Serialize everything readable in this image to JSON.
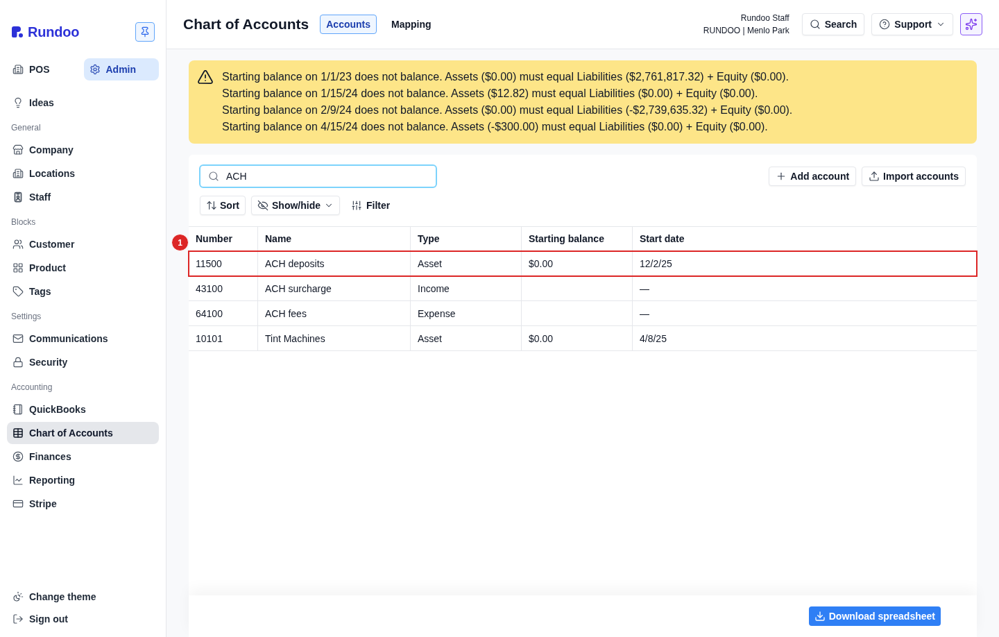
{
  "sidebar": {
    "logo": "Rundoo",
    "mode_switch": [
      {
        "label": "POS",
        "selected": false
      },
      {
        "label": "Admin",
        "selected": true
      }
    ],
    "top_items": [
      {
        "label": "Ideas",
        "selected": false
      }
    ],
    "sections": [
      {
        "title": "General",
        "items": [
          {
            "label": "Company",
            "selected": false
          },
          {
            "label": "Locations",
            "selected": false
          },
          {
            "label": "Staff",
            "selected": false
          }
        ]
      },
      {
        "title": "Blocks",
        "items": [
          {
            "label": "Customer",
            "selected": false
          },
          {
            "label": "Product",
            "selected": false
          },
          {
            "label": "Tags",
            "selected": false
          }
        ]
      },
      {
        "title": "Settings",
        "items": [
          {
            "label": "Communications",
            "selected": false
          },
          {
            "label": "Security",
            "selected": false
          }
        ]
      },
      {
        "title": "Accounting",
        "items": [
          {
            "label": "QuickBooks",
            "selected": false
          },
          {
            "label": "Chart of Accounts",
            "selected": true
          },
          {
            "label": "Finances",
            "selected": false
          },
          {
            "label": "Reporting",
            "selected": false
          },
          {
            "label": "Stripe",
            "selected": false
          }
        ]
      }
    ],
    "footer_items": [
      {
        "label": "Change theme"
      },
      {
        "label": "Sign out"
      }
    ]
  },
  "header": {
    "title": "Chart of Accounts",
    "tabs": [
      {
        "label": "Accounts",
        "selected": true
      },
      {
        "label": "Mapping",
        "selected": false
      }
    ],
    "user": {
      "name": "Rundoo Staff",
      "location": "RUNDOO | Menlo Park"
    },
    "search_button": "Search",
    "support_button": "Support"
  },
  "alert": {
    "lines": [
      "Starting balance on 1/1/23 does not balance. Assets ($0.00) must equal Liabilities ($2,761,817.32) + Equity ($0.00).",
      "Starting balance on 1/15/24 does not balance. Assets ($12.82) must equal Liabilities ($0.00) + Equity ($0.00).",
      "Starting balance on 2/9/24 does not balance. Assets ($0.00) must equal Liabilities (-$2,739,635.32) + Equity ($0.00).",
      "Starting balance on 4/15/24 does not balance. Assets (-$300.00) must equal Liabilities ($0.00) + Equity ($0.00)."
    ]
  },
  "toolbar": {
    "search": {
      "value": "ACH",
      "focused": true
    },
    "add_button": "Add account",
    "import_button": "Import accounts",
    "sort_button": "Sort",
    "show_hide_button": "Show/hide",
    "filter_button": "Filter"
  },
  "table": {
    "columns": [
      "Number",
      "Name",
      "Type",
      "Starting balance",
      "Start date"
    ],
    "rows": [
      {
        "number": "11500",
        "name": "ACH deposits",
        "type": "Asset",
        "starting_balance": "$0.00",
        "start_date": "12/2/25",
        "outlined": true,
        "marker": "1"
      },
      {
        "number": "43100",
        "name": "ACH surcharge",
        "type": "Income",
        "start_date": "—",
        "outlined": false
      },
      {
        "number": "64100",
        "name": "ACH fees",
        "type": "Expense",
        "start_date": "—",
        "outlined": false
      },
      {
        "number": "10101",
        "name": "Tint Machines",
        "type": "Asset",
        "starting_balance": "$0.00",
        "start_date": "4/8/25",
        "outlined": false
      }
    ]
  },
  "footer": {
    "download_button": "Download spreadsheet"
  }
}
